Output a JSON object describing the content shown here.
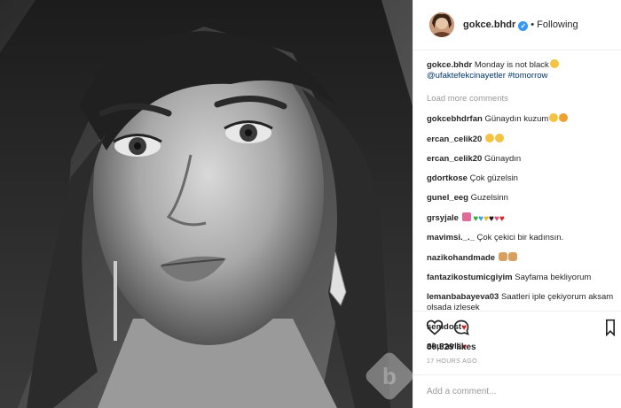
{
  "post": {
    "username": "gokce.bhdr",
    "separator": "•",
    "follow_status": "Following",
    "verified_icon": "checkmark-badge"
  },
  "caption": {
    "username": "gokce.bhdr",
    "text": "Monday is not black",
    "mention": "@ufaktefekcinayetler",
    "hashtag": "#tomorrow"
  },
  "load_more": "Load more comments",
  "comments": [
    {
      "user": "gokcebhdrfan",
      "text": "Günaydın kuzum"
    },
    {
      "user": "ercan_celik20",
      "text": ""
    },
    {
      "user": "ercan_celik20",
      "text": "Günaydın"
    },
    {
      "user": "gdortkose",
      "text": "Çok güzelsin"
    },
    {
      "user": "gunel_eeg",
      "text": "Guzelsinn"
    },
    {
      "user": "grsyjale",
      "text": ""
    },
    {
      "user": "mavimsi._._",
      "text": "Çok çekici bir kadınsın."
    },
    {
      "user": "nazikohandmade",
      "text": ""
    },
    {
      "user": "fantazikostumicgiyim",
      "text": "Sayfama bekliyorum"
    },
    {
      "user": "lemanbabayeva03",
      "text": "Saatleri iple çekiyorum aksam olsada izlesek"
    },
    {
      "user": "semdost",
      "text": ""
    },
    {
      "user": "okuravla",
      "text": ""
    }
  ],
  "stats": {
    "likes": "80,529 likes",
    "time": "17 HOURS AGO"
  },
  "add_comment": {
    "placeholder": "Add a comment..."
  },
  "colors": {
    "link": "#003569",
    "verified": "#3897f0",
    "muted": "#999999",
    "border": "#efefef"
  },
  "icons": [
    "heart-icon",
    "comment-icon",
    "bookmark-icon",
    "watermark-logo"
  ]
}
